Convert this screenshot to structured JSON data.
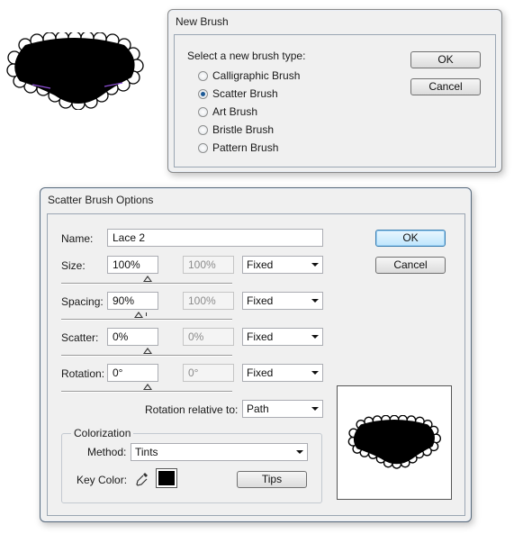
{
  "new_brush": {
    "title": "New Brush",
    "prompt": "Select a new brush type:",
    "options": [
      {
        "label": "Calligraphic Brush",
        "checked": false
      },
      {
        "label": "Scatter Brush",
        "checked": true
      },
      {
        "label": "Art Brush",
        "checked": false
      },
      {
        "label": "Bristle Brush",
        "checked": false
      },
      {
        "label": "Pattern Brush",
        "checked": false
      }
    ],
    "ok_label": "OK",
    "cancel_label": "Cancel"
  },
  "scatter": {
    "title": "Scatter Brush Options",
    "name_label": "Name:",
    "name_value": "Lace 2",
    "ok_label": "OK",
    "cancel_label": "Cancel",
    "size": {
      "label": "Size:",
      "value": "100%",
      "value2": "100%",
      "mode": "Fixed"
    },
    "spacing": {
      "label": "Spacing:",
      "value": "90%",
      "value2": "100%",
      "mode": "Fixed"
    },
    "scatter": {
      "label": "Scatter:",
      "value": "0%",
      "value2": "0%",
      "mode": "Fixed"
    },
    "rotation": {
      "label": "Rotation:",
      "value": "0°",
      "value2": "0°",
      "mode": "Fixed"
    },
    "rotation_relative_label": "Rotation relative to:",
    "rotation_relative_value": "Path",
    "colorization": {
      "title": "Colorization",
      "method_label": "Method:",
      "method_value": "Tints",
      "key_color_label": "Key Color:",
      "key_color": "#000000",
      "tips_label": "Tips"
    }
  },
  "colors": {
    "dialog_bg": "#f0f0f0",
    "default_button": "#bee6fd",
    "shape_fill": "#000000",
    "shape_highlight": "#8e4fd6"
  }
}
